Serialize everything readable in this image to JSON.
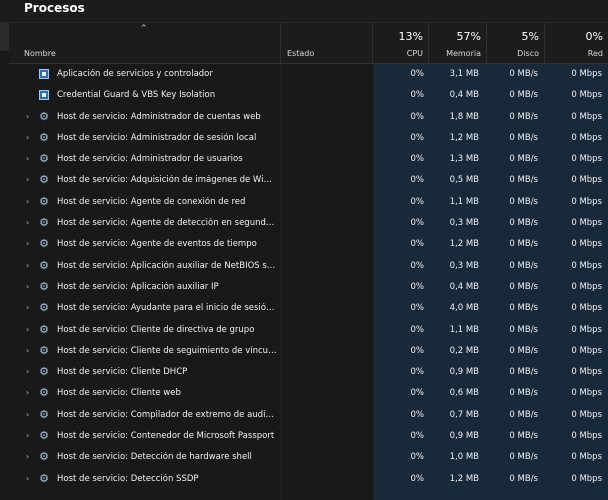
{
  "window": {
    "title": "Procesos"
  },
  "columns": {
    "name": {
      "label": "Nombre"
    },
    "status": {
      "label": "Estado"
    },
    "cpu": {
      "label": "CPU",
      "percent": "13%"
    },
    "memory": {
      "label": "Memoria",
      "percent": "57%"
    },
    "disk": {
      "label": "Disco",
      "percent": "5%"
    },
    "network": {
      "label": "Red",
      "percent": "0%"
    }
  },
  "colors": {
    "background": "#191919",
    "metric_column_bg": "#18293a",
    "text": "#ffffff"
  },
  "processes": [
    {
      "name": "Aplicación de servicios y controlador",
      "icon": "app-icon",
      "expandable": false,
      "cpu": "0%",
      "memory": "3,1 MB",
      "disk": "0 MB/s",
      "network": "0 Mbps"
    },
    {
      "name": "Credential Guard & VBS Key Isolation",
      "icon": "app-icon",
      "expandable": false,
      "cpu": "0%",
      "memory": "0,4 MB",
      "disk": "0 MB/s",
      "network": "0 Mbps"
    },
    {
      "name": "Host de servicio: Administrador de cuentas web",
      "icon": "gear-icon",
      "expandable": true,
      "cpu": "0%",
      "memory": "1,8 MB",
      "disk": "0 MB/s",
      "network": "0 Mbps"
    },
    {
      "name": "Host de servicio: Administrador de sesión local",
      "icon": "gear-icon",
      "expandable": true,
      "cpu": "0%",
      "memory": "1,2 MB",
      "disk": "0 MB/s",
      "network": "0 Mbps"
    },
    {
      "name": "Host de servicio: Administrador de usuarios",
      "icon": "gear-icon",
      "expandable": true,
      "cpu": "0%",
      "memory": "1,3 MB",
      "disk": "0 MB/s",
      "network": "0 Mbps"
    },
    {
      "name": "Host de servicio: Adquisición de imágenes de Windo...",
      "icon": "gear-icon",
      "expandable": true,
      "cpu": "0%",
      "memory": "0,5 MB",
      "disk": "0 MB/s",
      "network": "0 Mbps"
    },
    {
      "name": "Host de servicio: Agente de conexión de red",
      "icon": "gear-icon",
      "expandable": true,
      "cpu": "0%",
      "memory": "1,1 MB",
      "disk": "0 MB/s",
      "network": "0 Mbps"
    },
    {
      "name": "Host de servicio: Agente de detección en segundo pl...",
      "icon": "gear-icon",
      "expandable": true,
      "cpu": "0%",
      "memory": "0,3 MB",
      "disk": "0 MB/s",
      "network": "0 Mbps"
    },
    {
      "name": "Host de servicio: Agente de eventos de tiempo",
      "icon": "gear-icon",
      "expandable": true,
      "cpu": "0%",
      "memory": "1,2 MB",
      "disk": "0 MB/s",
      "network": "0 Mbps"
    },
    {
      "name": "Host de servicio: Aplicación auxiliar de NetBIOS sobre...",
      "icon": "gear-icon",
      "expandable": true,
      "cpu": "0%",
      "memory": "0,3 MB",
      "disk": "0 MB/s",
      "network": "0 Mbps"
    },
    {
      "name": "Host de servicio: Aplicación auxiliar IP",
      "icon": "gear-icon",
      "expandable": true,
      "cpu": "0%",
      "memory": "0,4 MB",
      "disk": "0 MB/s",
      "network": "0 Mbps"
    },
    {
      "name": "Host de servicio: Ayudante para el inicio de sesión de ...",
      "icon": "gear-icon",
      "expandable": true,
      "cpu": "0%",
      "memory": "4,0 MB",
      "disk": "0 MB/s",
      "network": "0 Mbps"
    },
    {
      "name": "Host de servicio: Cliente de directiva de grupo",
      "icon": "gear-icon",
      "expandable": true,
      "cpu": "0%",
      "memory": "1,1 MB",
      "disk": "0 MB/s",
      "network": "0 Mbps"
    },
    {
      "name": "Host de servicio: Cliente de seguimiento de vínculos ...",
      "icon": "gear-icon",
      "expandable": true,
      "cpu": "0%",
      "memory": "0,2 MB",
      "disk": "0 MB/s",
      "network": "0 Mbps"
    },
    {
      "name": "Host de servicio: Cliente DHCP",
      "icon": "gear-icon",
      "expandable": true,
      "cpu": "0%",
      "memory": "0,9 MB",
      "disk": "0 MB/s",
      "network": "0 Mbps"
    },
    {
      "name": "Host de servicio: Cliente web",
      "icon": "gear-icon",
      "expandable": true,
      "cpu": "0%",
      "memory": "0,6 MB",
      "disk": "0 MB/s",
      "network": "0 Mbps"
    },
    {
      "name": "Host de servicio: Compilador de extremo de audio de...",
      "icon": "gear-icon",
      "expandable": true,
      "cpu": "0%",
      "memory": "0,7 MB",
      "disk": "0 MB/s",
      "network": "0 Mbps"
    },
    {
      "name": "Host de servicio: Contenedor de Microsoft Passport",
      "icon": "gear-icon",
      "expandable": true,
      "cpu": "0%",
      "memory": "0,9 MB",
      "disk": "0 MB/s",
      "network": "0 Mbps"
    },
    {
      "name": "Host de servicio: Detección de hardware shell",
      "icon": "gear-icon",
      "expandable": true,
      "cpu": "0%",
      "memory": "1,0 MB",
      "disk": "0 MB/s",
      "network": "0 Mbps"
    },
    {
      "name": "Host de servicio: Detección SSDP",
      "icon": "gear-icon",
      "expandable": true,
      "cpu": "0%",
      "memory": "1,2 MB",
      "disk": "0 MB/s",
      "network": "0 Mbps"
    }
  ]
}
